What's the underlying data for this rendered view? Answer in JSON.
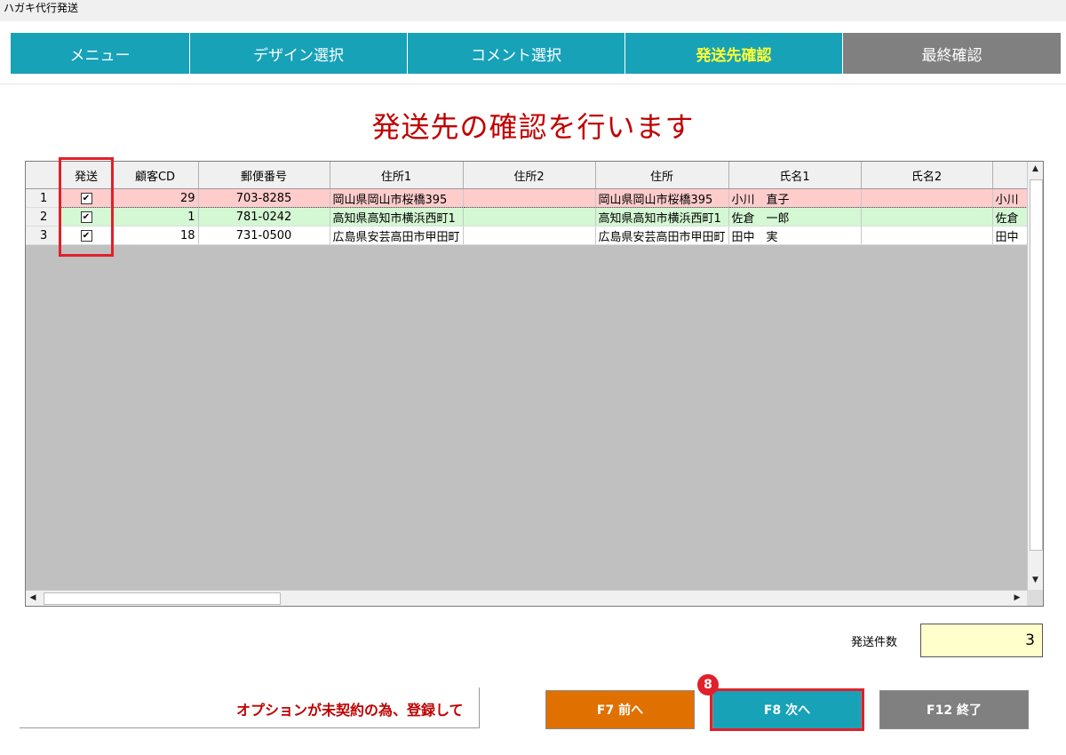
{
  "window": {
    "title": "ハガキ代行発送"
  },
  "tabs": [
    {
      "label": "メニュー"
    },
    {
      "label": "デザイン選択"
    },
    {
      "label": "コメント選択"
    },
    {
      "label": "発送先確認"
    },
    {
      "label": "最終確認"
    }
  ],
  "page_title": "発送先の確認を行います",
  "grid": {
    "columns": [
      "発送",
      "顧客CD",
      "郵便番号",
      "住所1",
      "住所2",
      "住所",
      "氏名1",
      "氏名2",
      ""
    ],
    "rows": [
      {
        "num": "1",
        "send": "✔",
        "cd": "29",
        "zip": "703-8285",
        "addr1": "岡山県岡山市桜橋395",
        "addr2": "",
        "addr": "岡山県岡山市桜橋395",
        "name1": "小川　直子",
        "name2": "",
        "extra": "小川"
      },
      {
        "num": "2",
        "send": "✔",
        "cd": "1",
        "zip": "781-0242",
        "addr1": "高知県高知市横浜西町1",
        "addr2": "",
        "addr": "高知県高知市横浜西町1",
        "name1": "佐倉　一郎",
        "name2": "",
        "extra": "佐倉"
      },
      {
        "num": "3",
        "send": "✔",
        "cd": "18",
        "zip": "731-0500",
        "addr1": "広島県安芸高田市甲田町",
        "addr2": "",
        "addr": "広島県安芸高田市甲田町",
        "name1": "田中　実",
        "name2": "",
        "extra": "田中"
      }
    ]
  },
  "count": {
    "label": "発送件数",
    "value": "3"
  },
  "message": "オプションが未契約の為、登録して",
  "buttons": {
    "prev": "F7 前へ",
    "next": "F8 次へ",
    "exit": "F12 終了"
  },
  "marker": "8",
  "colors": {
    "tab": "#17a2b8",
    "tab_disabled": "#808080",
    "title": "#c00000",
    "prev": "#e07000",
    "highlight": "#e0202a"
  }
}
